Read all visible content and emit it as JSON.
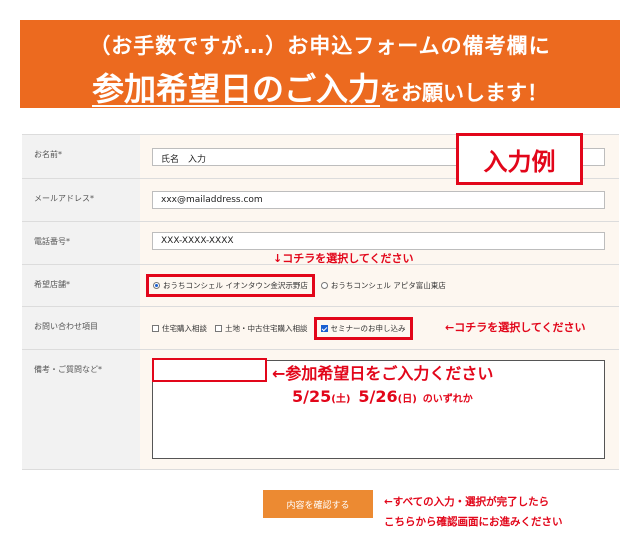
{
  "banner": {
    "line1": "（お手数ですが…）お申込フォームの備考欄に",
    "line2_big": "参加希望日のご入力",
    "line2_small": "をお願いします！"
  },
  "form": {
    "name_label": "お名前*",
    "name_value": "氏名　入力",
    "email_label": "メールアドレス*",
    "email_value": "xxx@mailaddress.com",
    "phone_label": "電話番号*",
    "phone_value": "XXX-XXXX-XXXX",
    "store_label": "希望店舗*",
    "store_options": [
      "おうちコンシェル イオンタウン金沢示野店",
      "おうちコンシェル アピタ富山東店"
    ],
    "inquiry_label": "お問い合わせ項目",
    "inquiry_options": [
      "住宅購入相談",
      "土地・中古住宅購入相談",
      "セミナーのお申し込み"
    ],
    "notes_label": "備考・ご質問など*",
    "submit_label": "内容を確認する"
  },
  "annotations": {
    "example_stamp": "入力例",
    "select_above": "↓コチラを選択してください",
    "select_left": "←コチラを選択してください",
    "notes_hint": "←参加希望日をご入力ください",
    "date1": "5/25",
    "date1_day": "(土)",
    "date2": "5/26",
    "date2_day": "(日)",
    "either": "のいずれか",
    "submit_hint_1": "←すべての入力・選択が完了したら",
    "submit_hint_2": "こちらから確認画面にお進みください"
  },
  "colors": {
    "banner": "#ec6a1f",
    "accent_red": "#e2061a",
    "submit": "#ec8a32"
  }
}
